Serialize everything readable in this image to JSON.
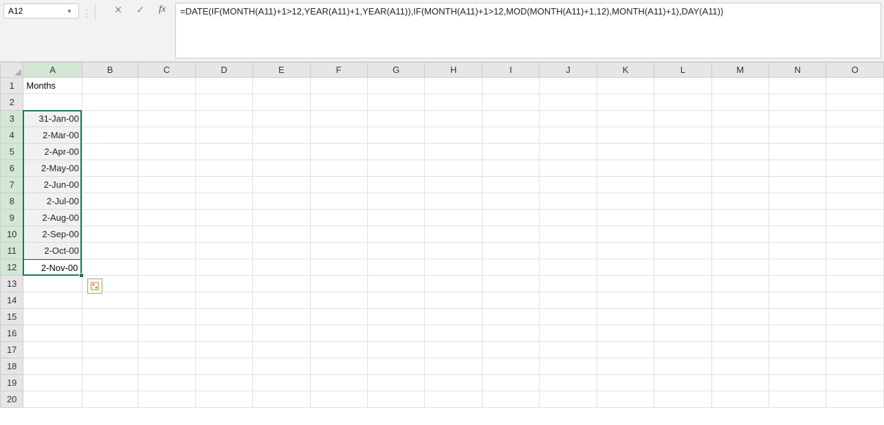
{
  "name_box": {
    "value": "A12"
  },
  "formula_bar": {
    "cancel_glyph": "✕",
    "enter_glyph": "✓",
    "fx_glyph": "fx",
    "text": "=DATE(IF(MONTH(A11)+1>12,YEAR(A11)+1,YEAR(A11)),IF(MONTH(A11)+1>12,MOD(MONTH(A11)+1,12),MONTH(A11)+1),DAY(A11))"
  },
  "columns": [
    "A",
    "B",
    "C",
    "D",
    "E",
    "F",
    "G",
    "H",
    "I",
    "J",
    "K",
    "L",
    "M",
    "N",
    "O"
  ],
  "rows": [
    1,
    2,
    3,
    4,
    5,
    6,
    7,
    8,
    9,
    10,
    11,
    12,
    13,
    14,
    15,
    16,
    17,
    18,
    19,
    20
  ],
  "cells": {
    "A1": "Months",
    "A3": "31-Jan-00",
    "A4": "2-Mar-00",
    "A5": "2-Apr-00",
    "A6": "2-May-00",
    "A7": "2-Jun-00",
    "A8": "2-Jul-00",
    "A9": "2-Aug-00",
    "A10": "2-Sep-00",
    "A11": "2-Oct-00",
    "A12": "2-Nov-00"
  },
  "selection": {
    "col": "A",
    "row_start": 3,
    "row_end": 12,
    "active_row": 12
  },
  "chart_data": {
    "type": "table",
    "title": "Months",
    "categories": [
      "31-Jan-00",
      "2-Mar-00",
      "2-Apr-00",
      "2-May-00",
      "2-Jun-00",
      "2-Jul-00",
      "2-Aug-00",
      "2-Sep-00",
      "2-Oct-00",
      "2-Nov-00"
    ]
  }
}
